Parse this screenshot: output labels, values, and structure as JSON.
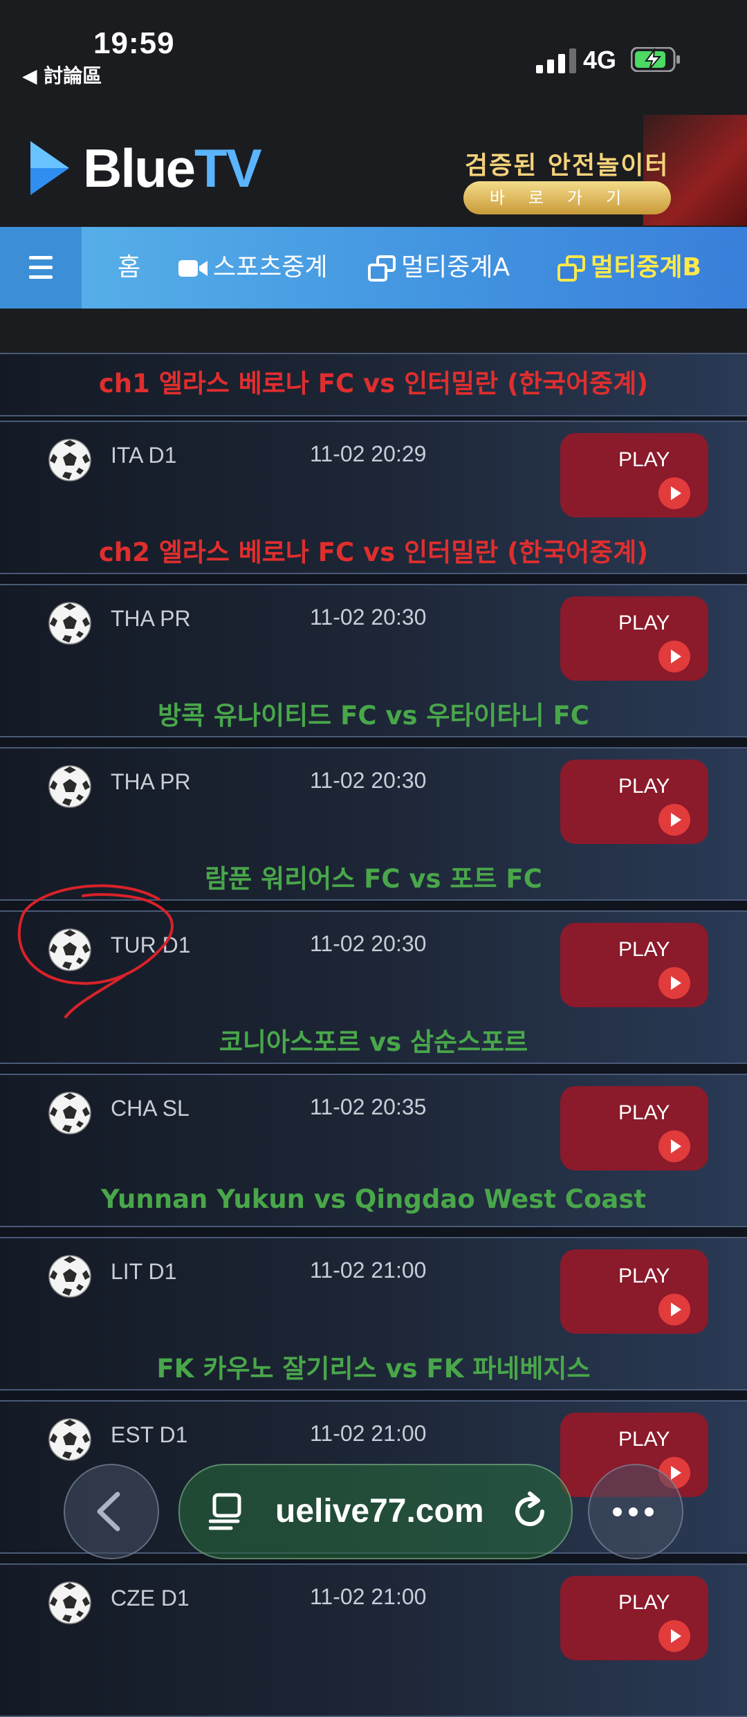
{
  "status": {
    "time": "19:59",
    "back_app": "◀ 討論區",
    "network": "4G"
  },
  "header": {
    "logo_blue": "Blue",
    "logo_tv": "TV",
    "promo_title": "검증된 안전놀이터",
    "promo_button": "바로가기"
  },
  "nav": {
    "items": [
      {
        "label": "홈"
      },
      {
        "label": "스포츠중계"
      },
      {
        "label": "멀티중계A"
      },
      {
        "label": "멀티중계B"
      }
    ]
  },
  "partial_match": {
    "title": "ch1 엘라스 베로나 FC vs 인터밀란 (한국어중계)",
    "color": "#e02e2e"
  },
  "matches": [
    {
      "league": "ITA D1",
      "datetime": "11-02 20:29",
      "title": "ch2 엘라스 베로나 FC vs 인터밀란 (한국어중계)",
      "color": "red"
    },
    {
      "league": "THA PR",
      "datetime": "11-02 20:30",
      "title": "방콕 유나이티드 FC vs 우타이타니 FC",
      "color": "green"
    },
    {
      "league": "THA PR",
      "datetime": "11-02 20:30",
      "title": "람푼 워리어스 FC vs 포트 FC",
      "color": "green"
    },
    {
      "league": "TUR D1",
      "datetime": "11-02 20:30",
      "title": "코니아스포르 vs 삼순스포르",
      "color": "green"
    },
    {
      "league": "CHA SL",
      "datetime": "11-02 20:35",
      "title": "Yunnan Yukun vs Qingdao West Coast",
      "color": "green"
    },
    {
      "league": "LIT D1",
      "datetime": "11-02 21:00",
      "title": "FK 카우노 잘기리스 vs FK 파네베지스",
      "color": "green"
    },
    {
      "league": "EST D1",
      "datetime": "11-02 21:00",
      "title": "",
      "color": "green"
    },
    {
      "league": "CZE D1",
      "datetime": "11-02 21:00",
      "title": "",
      "color": "green"
    }
  ],
  "play_label": "PLAY",
  "browser": {
    "url": "uelive77.com"
  },
  "colors": {
    "nav_active": "#ffe94a",
    "play_button": "#8b1a2b",
    "match_green": "#49a74a",
    "match_red": "#e02e2e"
  }
}
